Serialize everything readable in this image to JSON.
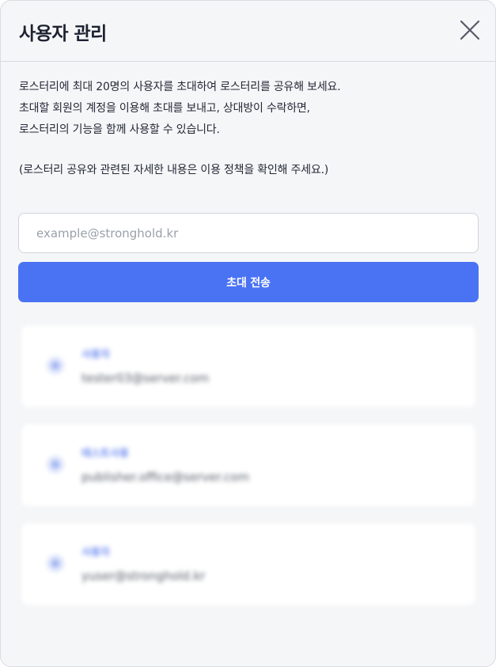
{
  "dialog": {
    "title": "사용자 관리",
    "close_icon": "close-icon"
  },
  "description": {
    "lines": [
      "로스터리에 최대 20명의 사용자를 초대하여 로스터리를 공유해 보세요.",
      "초대할 회원의 계정을 이용해 초대를 보내고, 상대방이 수락하면,",
      "로스터리의 기능을 함께 사용할 수 있습니다."
    ],
    "note": "(로스터리 공유와 관련된 자세한 내용은 이용 정책을 확인해 주세요.)"
  },
  "invite": {
    "email_value": "",
    "email_placeholder": "example@stronghold.kr",
    "send_label": "초대 전송",
    "button_color": "#4a73f4"
  },
  "users": [
    {
      "name": "사용자",
      "email": "tester03@server.com",
      "avatar_icon": "user-avatar-icon"
    },
    {
      "name": "테스트사용",
      "email": "publisher.office@server.com",
      "avatar_icon": "user-avatar-icon"
    },
    {
      "name": "사용자",
      "email": "yuser@stronghold.kr",
      "avatar_icon": "user-avatar-icon"
    }
  ]
}
